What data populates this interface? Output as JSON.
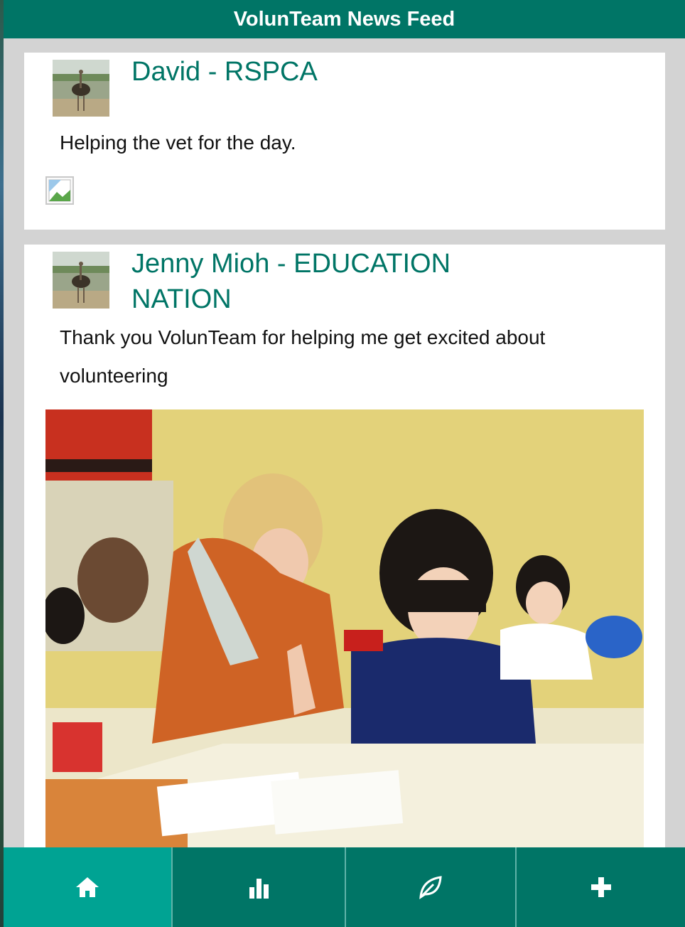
{
  "header": {
    "title": "VolunTeam News Feed"
  },
  "posts": [
    {
      "author": "David - RSPCA",
      "avatar_icon": "ostrich-avatar-image",
      "text": "Helping the vet for the day.",
      "attachment": "broken-image-icon"
    },
    {
      "author": "Jenny Mioh - EDUCATION NATION",
      "avatar_icon": "ostrich-avatar-image",
      "text": "Thank you VolunTeam for helping me get excited about volunteering",
      "attachment": "classroom-photo"
    }
  ],
  "tabs": [
    {
      "icon": "home-icon",
      "active": true
    },
    {
      "icon": "bar-chart-icon",
      "active": false
    },
    {
      "icon": "leaf-icon",
      "active": false
    },
    {
      "icon": "plus-icon",
      "active": false
    }
  ],
  "colors": {
    "header": "#007566",
    "accent": "#007566",
    "tab_active": "#00a393",
    "background": "#d3d3d3"
  }
}
